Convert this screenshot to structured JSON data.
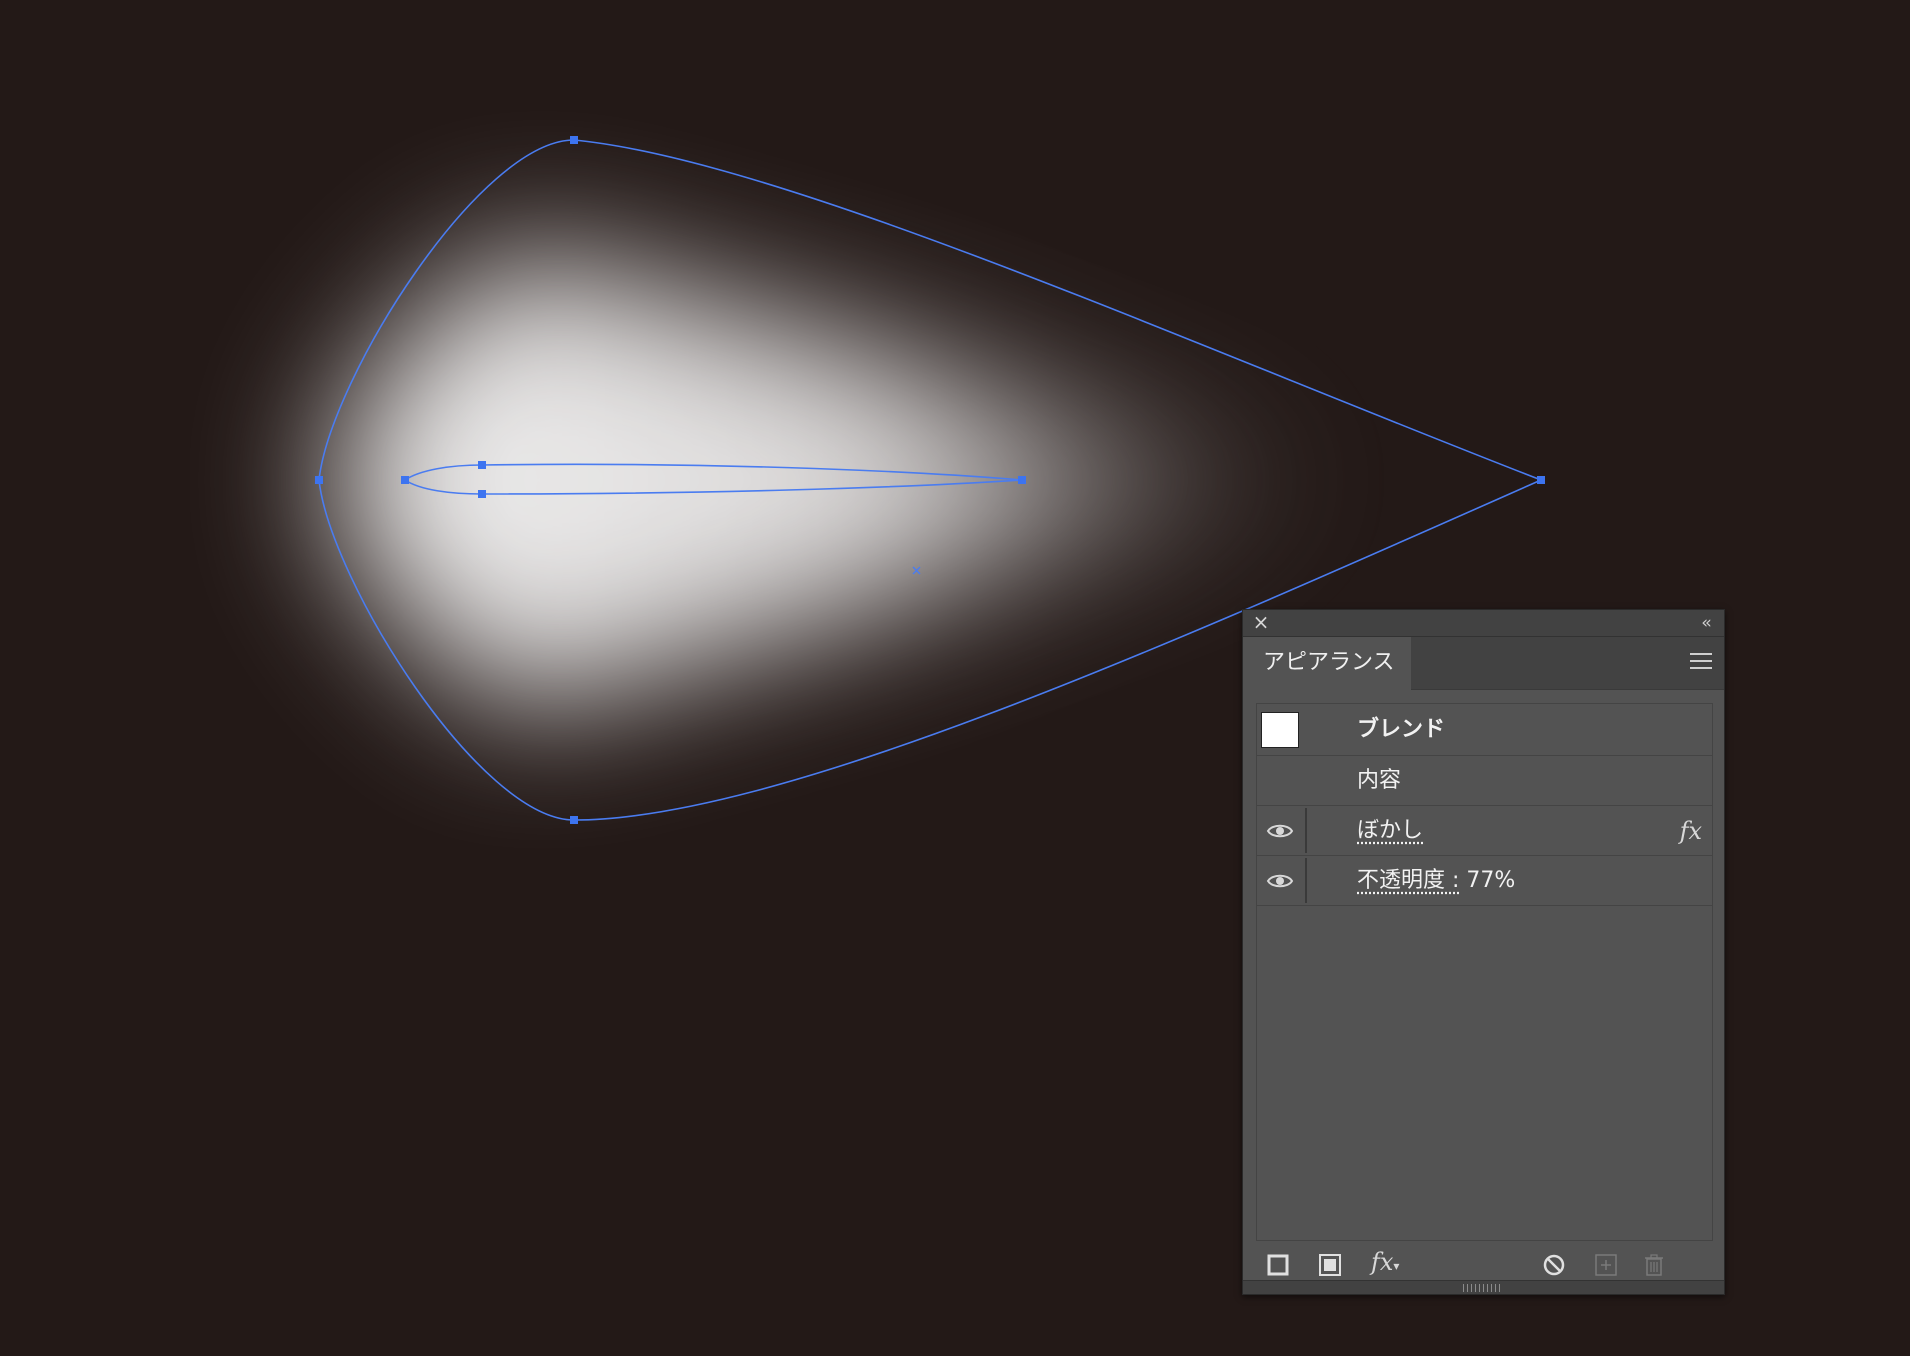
{
  "colors": {
    "canvas_bg": "#231917",
    "path_stroke": "#4a7cf0",
    "anchor": "#3d74f0",
    "panel_bg": "#535353",
    "panel_header": "#424242",
    "text": "#f2f2f2"
  },
  "panel": {
    "close_icon": "close-icon",
    "collapse_icon": "double-chevron-left-icon",
    "tab_label": "アピアランス",
    "menu_icon": "hamburger-menu-icon",
    "rows": [
      {
        "label": "ブレンド",
        "swatch": "#ffffff"
      },
      {
        "label": "内容"
      },
      {
        "label": "ぼかし",
        "visible": true,
        "fx": "fx"
      },
      {
        "label_link": "不透明度 :",
        "label_value": " 77%",
        "visible": true
      }
    ],
    "footer": {
      "add_stroke_icon": "add-stroke-icon",
      "add_fill_icon": "add-fill-icon",
      "add_effect": "fx",
      "clear_icon": "clear-appearance-icon",
      "duplicate_icon": "duplicate-item-icon",
      "delete_icon": "trash-icon"
    }
  }
}
